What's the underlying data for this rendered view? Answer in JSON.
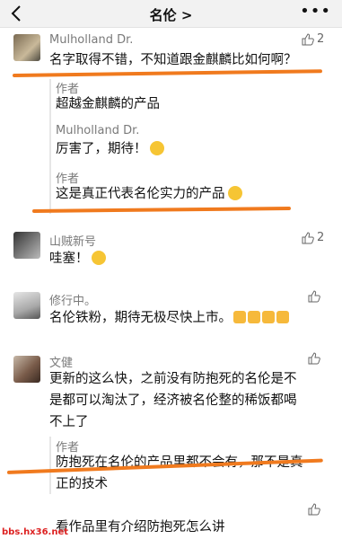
{
  "header": {
    "title": "名伦 >",
    "back_icon": "chevron-left-icon",
    "more_icon": "more-dots-icon"
  },
  "comments": [
    {
      "user": "Mulholland Dr.",
      "text": "名字取得不错，不知道跟金麒麟比如何啊？",
      "likes": "2",
      "replies": [
        {
          "user": "作者",
          "text": "超越金麒麟的产品"
        },
        {
          "user": "Mulholland Dr.",
          "text": "厉害了，期待！"
        },
        {
          "user": "作者",
          "text": "这是真正代表名伦实力的产品"
        }
      ]
    },
    {
      "user": "山贼新号",
      "text": "哇塞！",
      "likes": "2"
    },
    {
      "user": "修行中。",
      "text": "名伦铁粉，期待无极尽快上市。"
    },
    {
      "user": "文健",
      "text_line1": "更新的这么快，之前没有防抱死的名伦是不",
      "text_line2": "是都可以淘汰了，经济被名伦整的稀饭都喝",
      "text_line3": "不上了",
      "replies": [
        {
          "user": "作者",
          "text_line1": "防抱死在名伦的产品里都不会有，那不是真",
          "text_line2": "正的技术"
        }
      ]
    },
    {
      "text": "看作品里有介绍防抱死怎么讲"
    }
  ],
  "watermark": "bbs.hx36.net",
  "colors": {
    "highlight": "#f07a1e",
    "emoji": "#f6c534"
  }
}
